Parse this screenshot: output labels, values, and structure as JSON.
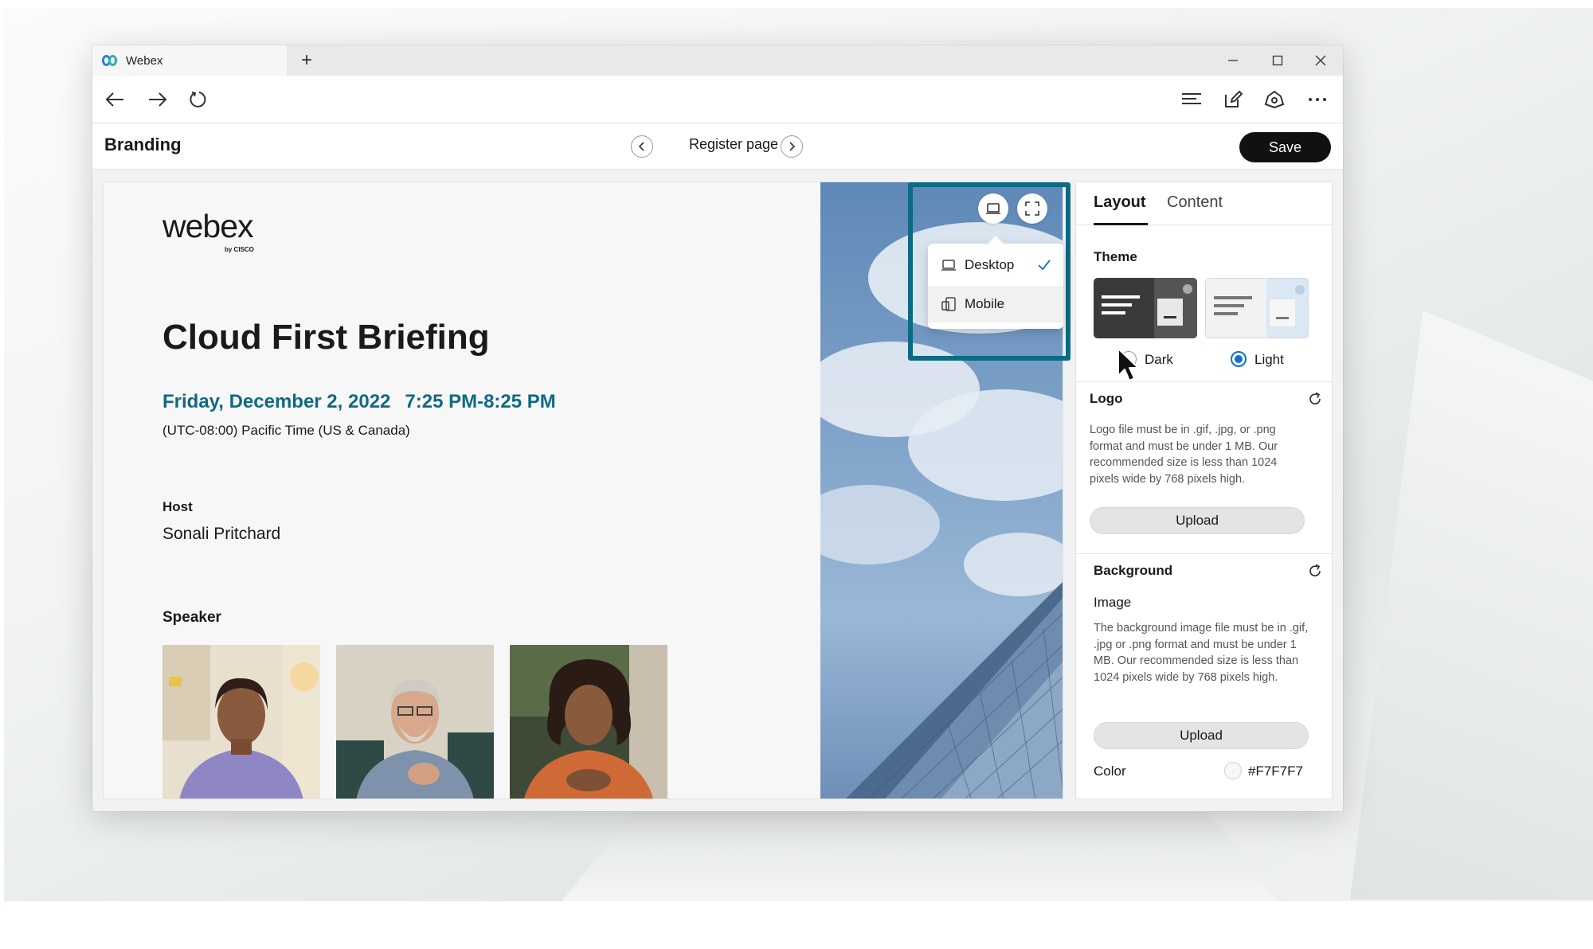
{
  "browser": {
    "tab_title": "Webex",
    "new_tab": "+"
  },
  "appbar": {
    "title": "Branding",
    "page_label": "Register page",
    "save_label": "Save"
  },
  "event": {
    "brand_word": "webex",
    "brand_by": "by CISCO",
    "title": "Cloud First Briefing",
    "date": "Friday, December 2, 2022",
    "time": "7:25 PM-8:25 PM",
    "timezone": "(UTC-08:00) Pacific Time (US & Canada)",
    "host_label": "Host",
    "host_name": "Sonali Pritchard",
    "speaker_label": "Speaker"
  },
  "preview": {
    "options": [
      {
        "label": "Desktop",
        "icon": "laptop-icon",
        "selected": true
      },
      {
        "label": "Mobile",
        "icon": "mobile-icon",
        "selected": false
      }
    ]
  },
  "panel": {
    "tabs": [
      "Layout",
      "Content"
    ],
    "active_tab": "Layout",
    "theme": {
      "title": "Theme",
      "options": [
        "Dark",
        "Light"
      ],
      "selected": "Light"
    },
    "logo": {
      "title": "Logo",
      "help": "Logo file must be in .gif, .jpg, or .png format and must be under 1 MB. Our recommended size is less than 1024 pixels wide by 768 pixels high.",
      "upload_label": "Upload"
    },
    "background": {
      "title": "Background",
      "image_label": "Image",
      "help": "The background image file must be in .gif, .jpg or .png format and must be under 1 MB. Our recommended size is less than 1024 pixels wide by 768 pixels high.",
      "upload_label": "Upload",
      "color_label": "Color",
      "color_value": "#F7F7F7"
    }
  },
  "colors": {
    "accent": "#0d6a85",
    "date_text": "#0f6a82",
    "radio_selected": "#1170cf",
    "save_button": "#111111"
  }
}
